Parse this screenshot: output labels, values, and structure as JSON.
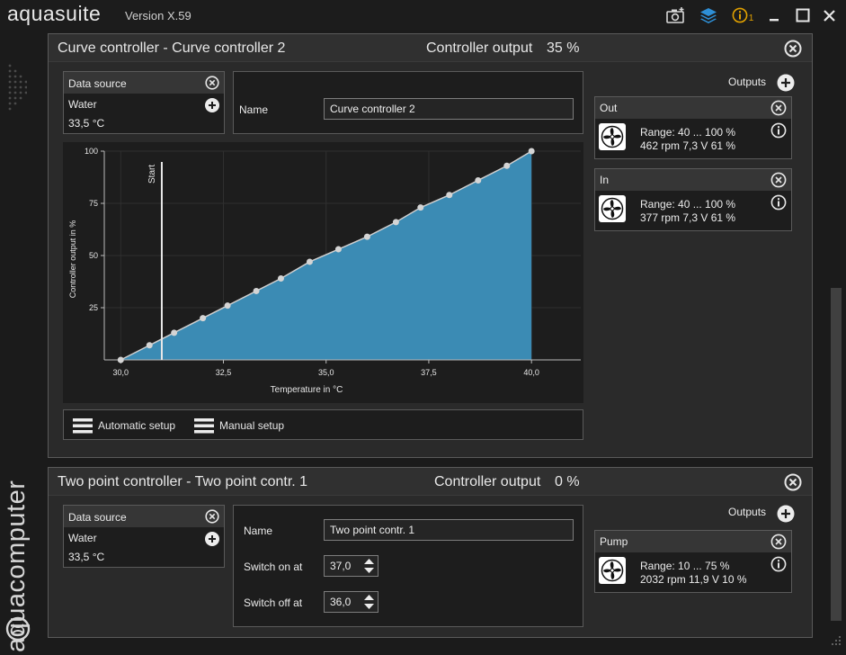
{
  "titlebar": {
    "app_name": "aquasuite",
    "version": "Version X.59",
    "info_count": "1",
    "icons": [
      "screenshot-icon",
      "layers-icon",
      "info-icon",
      "minimize-icon",
      "maximize-icon",
      "close-icon"
    ]
  },
  "brand": {
    "text": "aquacomputer"
  },
  "colors": {
    "accent_fill": "#3b8bb4",
    "warning": "#e0a000",
    "layers": "#2e8fd6"
  },
  "curve_panel": {
    "title": "Curve controller  -  Curve controller 2",
    "output_label": "Controller output",
    "output_value": "35 %",
    "data_source": {
      "header": "Data source",
      "name": "Water",
      "value": "33,5 °C"
    },
    "name_label": "Name",
    "name_value": "Curve controller 2",
    "outputs_label": "Outputs",
    "outputs": [
      {
        "name": "Out",
        "range": "Range:  40 ... 100  %",
        "stats": "462 rpm  7,3 V  61 %"
      },
      {
        "name": "In",
        "range": "Range:  40 ... 100  %",
        "stats": "377 rpm  7,3 V  61 %"
      }
    ],
    "automatic_setup": "Automatic setup",
    "manual_setup": "Manual setup"
  },
  "chart_data": {
    "type": "area",
    "xlabel": "Temperature in °C",
    "ylabel": "Controller output in %",
    "xlim": [
      29.6,
      41.2
    ],
    "ylim": [
      0,
      100
    ],
    "x_ticks": [
      "30,0",
      "32,5",
      "35,0",
      "37,5",
      "40,0"
    ],
    "x_tick_values": [
      30,
      32.5,
      35,
      37.5,
      40
    ],
    "y_ticks": [
      "25",
      "50",
      "75",
      "100"
    ],
    "y_tick_values": [
      25,
      50,
      75,
      100
    ],
    "start_label": "Start",
    "start_x": 31.0,
    "x": [
      30.0,
      30.7,
      31.3,
      32.0,
      32.6,
      33.3,
      33.9,
      34.6,
      35.3,
      36.0,
      36.7,
      37.3,
      38.0,
      38.7,
      39.4,
      40.0
    ],
    "values": [
      0,
      7,
      13,
      20,
      26,
      33,
      39,
      47,
      53,
      59,
      66,
      73,
      79,
      86,
      93,
      100
    ]
  },
  "twopoint_panel": {
    "title": "Two point controller  -  Two point contr. 1",
    "output_label": "Controller output",
    "output_value": "0 %",
    "data_source": {
      "header": "Data source",
      "name": "Water",
      "value": "33,5 °C"
    },
    "name_label": "Name",
    "name_value": "Two point contr. 1",
    "switch_on_label": "Switch on at",
    "switch_on_value": "37,0",
    "switch_off_label": "Switch off at",
    "switch_off_value": "36,0",
    "outputs_label": "Outputs",
    "outputs": [
      {
        "name": "Pump",
        "range": "Range:  10 ... 75  %",
        "stats": "2032 rpm  11,9 V  10 %"
      }
    ]
  }
}
